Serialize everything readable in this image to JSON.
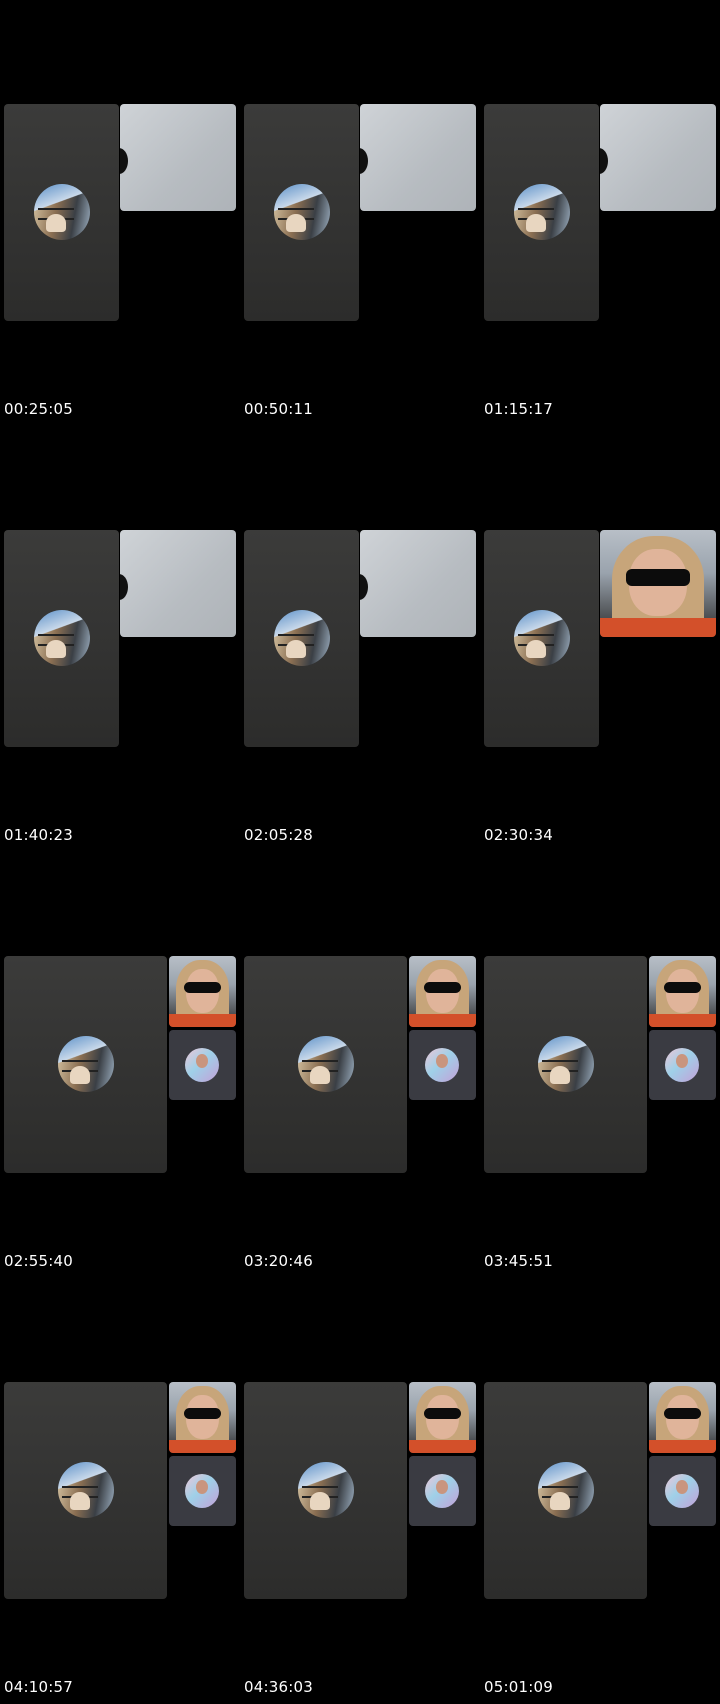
{
  "frames": [
    {
      "timestamp": "00:25:05",
      "layout": "two-tile",
      "remote": "blank"
    },
    {
      "timestamp": "00:50:11",
      "layout": "two-tile",
      "remote": "blank"
    },
    {
      "timestamp": "01:15:17",
      "layout": "two-tile",
      "remote": "blank"
    },
    {
      "timestamp": "01:40:23",
      "layout": "two-tile",
      "remote": "blank"
    },
    {
      "timestamp": "02:05:28",
      "layout": "two-tile",
      "remote": "blank"
    },
    {
      "timestamp": "02:30:34",
      "layout": "two-tile",
      "remote": "face"
    },
    {
      "timestamp": "02:55:40",
      "layout": "three-tile",
      "remote": "face"
    },
    {
      "timestamp": "03:20:46",
      "layout": "three-tile",
      "remote": "face"
    },
    {
      "timestamp": "03:45:51",
      "layout": "three-tile",
      "remote": "face"
    },
    {
      "timestamp": "04:10:57",
      "layout": "three-tile",
      "remote": "face"
    },
    {
      "timestamp": "04:36:03",
      "layout": "three-tile",
      "remote": "face"
    },
    {
      "timestamp": "05:01:09",
      "layout": "three-tile",
      "remote": "face"
    }
  ],
  "colors": {
    "background": "#000000",
    "tile": "#333332",
    "small_tile": "#3a3b42",
    "shirt": "#d3502a"
  }
}
